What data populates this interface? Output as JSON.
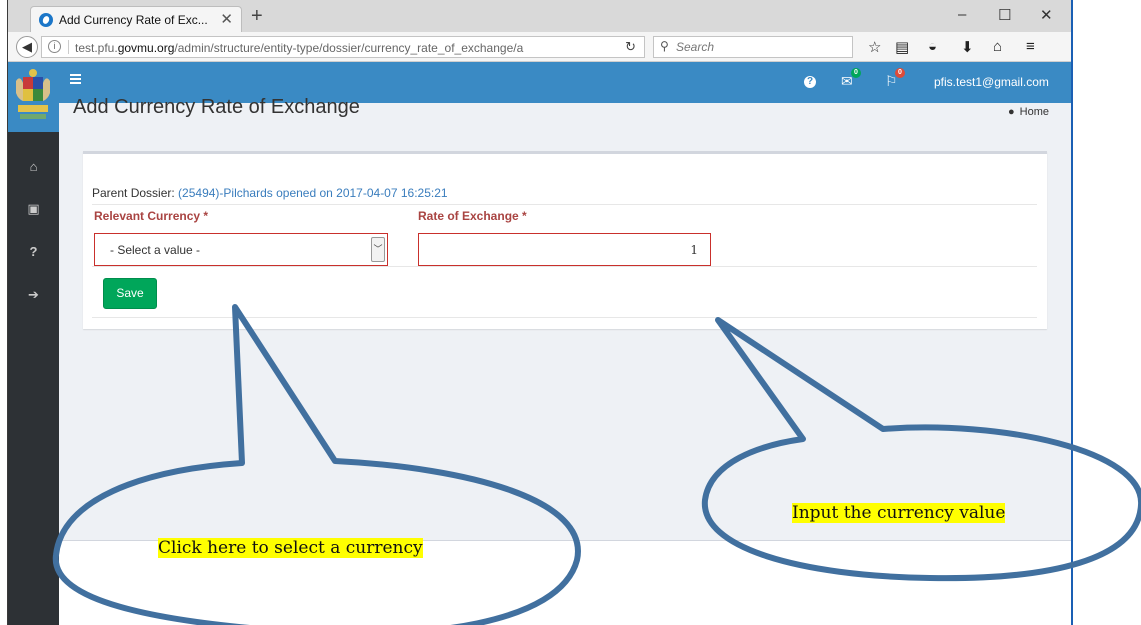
{
  "browser": {
    "tab_title": "Add Currency Rate of Exc...",
    "tab_close": "✕",
    "new_tab": "+",
    "url_host_prefix": "test.pfu.",
    "url_host_main": "govmu.org",
    "url_path": "/admin/structure/entity-type/dossier/currency_rate_of_exchange/a",
    "search_placeholder": "Search",
    "window_controls": {
      "minimize": "–",
      "maximize": "☐",
      "close": "✕"
    }
  },
  "topbar": {
    "user_email": "pfis.test1@gmail.com",
    "messages_count": "0",
    "flags_count": "0",
    "help_glyph": "?"
  },
  "sidebar": {
    "items": [
      {
        "name": "home-icon",
        "glyph": "⌂"
      },
      {
        "name": "document-icon",
        "glyph": "▣"
      },
      {
        "name": "help-icon",
        "glyph": "?"
      },
      {
        "name": "logout-icon",
        "glyph": "➔"
      }
    ]
  },
  "page": {
    "title": "Add Currency Rate of Exchange",
    "home_link": "Home"
  },
  "form": {
    "parent_label": "Parent Dossier:",
    "parent_value": "(25494)-Pilchards opened on 2017-04-07 16:25:21",
    "currency_label": "Relevant Currency *",
    "currency_selected": "- Select a value -",
    "rate_label": "Rate of Exchange *",
    "rate_value": "1",
    "save_label": "Save"
  },
  "annotations": {
    "currency_hint": "Click here to select a currency",
    "rate_hint": "Input the currency value",
    "callout_color": "#41709f",
    "highlight_color": "#ffff00"
  },
  "colors": {
    "header_blue": "#3a8ac4",
    "sidebar_dark": "#2d3135",
    "save_green": "#00a65a",
    "error_red": "#a94442"
  }
}
